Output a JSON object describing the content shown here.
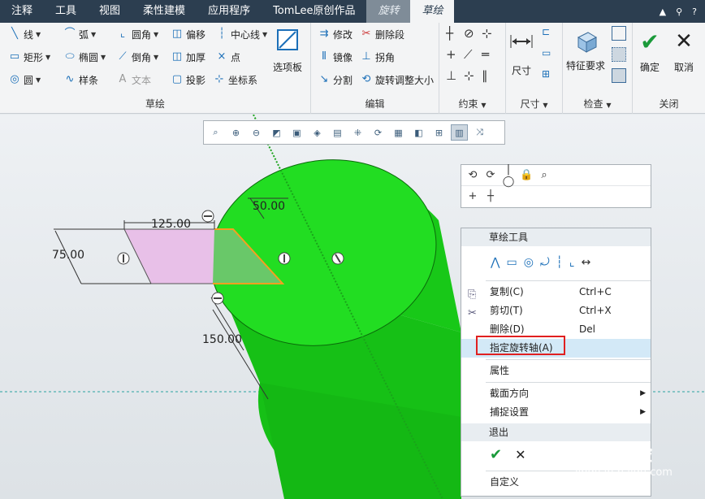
{
  "tabs": [
    "注释",
    "工具",
    "视图",
    "柔性建模",
    "应用程序",
    "TomLee原创作品",
    "旋转",
    "草绘"
  ],
  "ribbon": {
    "sketch_items": [
      "线",
      "弧",
      "圆角",
      "偏移",
      "中心线",
      "矩形",
      "椭圆",
      "倒角",
      "加厚",
      "点",
      "圆",
      "样条",
      "文本",
      "投影",
      "坐标系"
    ],
    "palette_label": "选项板",
    "sketch_label": "草绘",
    "edit_items": [
      "修改",
      "删除段",
      "镜像",
      "拐角",
      "分割",
      "旋转调整大小"
    ],
    "edit_label": "编辑",
    "constraint_label": "约束",
    "dimension_btn": "尺寸",
    "dimension_label": "尺寸",
    "feature_req": "特征要求",
    "inspect_label": "检查",
    "ok_label": "确定",
    "cancel_label": "取消",
    "close_label": "关闭"
  },
  "dimensions": {
    "d1": "125.00",
    "d2": "50.00",
    "d3": "75.00",
    "d4": "150.00"
  },
  "context_menu": {
    "header": "草绘工具",
    "items": [
      {
        "label": "复制(C)",
        "shortcut": "Ctrl+C"
      },
      {
        "label": "剪切(T)",
        "shortcut": "Ctrl+X"
      },
      {
        "label": "删除(D)",
        "shortcut": "Del"
      },
      {
        "label": "指定旋转轴(A)",
        "shortcut": ""
      },
      {
        "label": "属性",
        "shortcut": ""
      },
      {
        "label": "截面方向",
        "shortcut": ""
      },
      {
        "label": "捕捉设置",
        "shortcut": ""
      }
    ],
    "exit_header": "退出",
    "custom": "自定义"
  },
  "watermark": {
    "logo": "Baidu经验",
    "url": "jingyan.baidu.com"
  },
  "colors": {
    "cylinder": "#22dd22",
    "section_fill": "#e8c0e8",
    "highlight": "#d3e9f7",
    "red_box": "#e02020"
  }
}
